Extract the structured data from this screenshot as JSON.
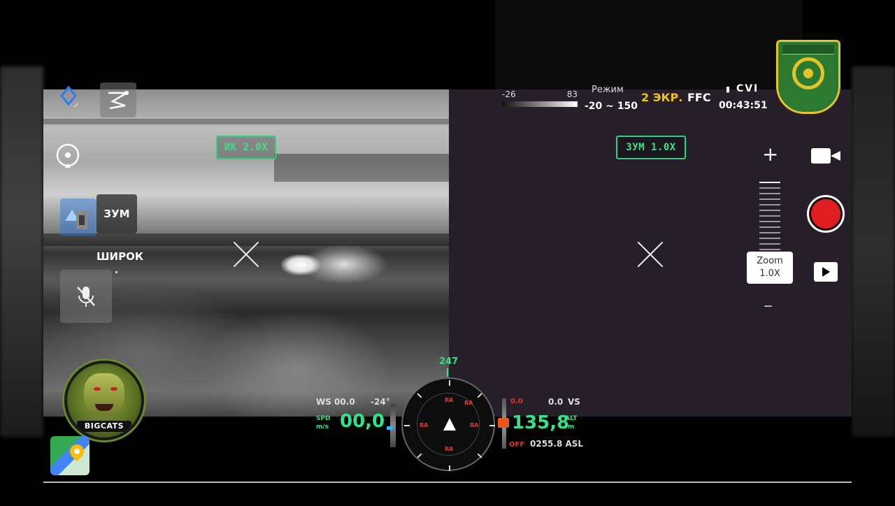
{
  "status_bar": {
    "temp_min": "-26",
    "temp_max": "83",
    "mode_label": "Режим",
    "mode_range": "-20 ~ 150",
    "screen_mode": "2 ЭКР.",
    "ffc": "FFC",
    "recording_indicator": "CVI",
    "recording_time": "00:43:51"
  },
  "ir_view": {
    "label": "ИК 2.0X"
  },
  "zoom_view": {
    "label": "ЗУМ 1.0X"
  },
  "left_panel": {
    "zoom_button": "ЗУМ",
    "wide_label": "ШИРОК",
    "logo_text": "BIGCATS"
  },
  "zoom_slider": {
    "plus": "+",
    "minus": "–",
    "zoom_title": "Zoom",
    "zoom_value": "1.0X"
  },
  "telemetry": {
    "heading": "247",
    "wind": "WS 00.0",
    "wind_angle": "-24°",
    "spd_label_top": "SPD",
    "spd_label_bottom": "m/s",
    "speed": "00,0",
    "vs_left": "0.0",
    "vs_value": "0.0",
    "vs_label": "VS",
    "altitude": "135,8",
    "alt_label_top": "ALT",
    "alt_label_bottom": "m",
    "off_label": "OFF",
    "asl": "0255.8 ASL",
    "compass_marks": [
      "RA",
      "RA",
      "RA",
      "RA",
      "RA"
    ]
  },
  "icons": {
    "location": "location-icon",
    "route": "route-icon",
    "target": "target-icon",
    "mic_off": "mic-off-icon",
    "video_camera": "video-camera-icon",
    "record": "record-button",
    "playback": "play-icon",
    "maps": "maps-icon"
  },
  "colors": {
    "hud_green": "#31e38a",
    "label_border": "#2fd27e",
    "screen_mode": "#f2c21a",
    "record_red": "#e01e22",
    "warning_red": "#e33333",
    "alt_marker": "#e8591c",
    "speed_marker": "#27b9ff"
  }
}
